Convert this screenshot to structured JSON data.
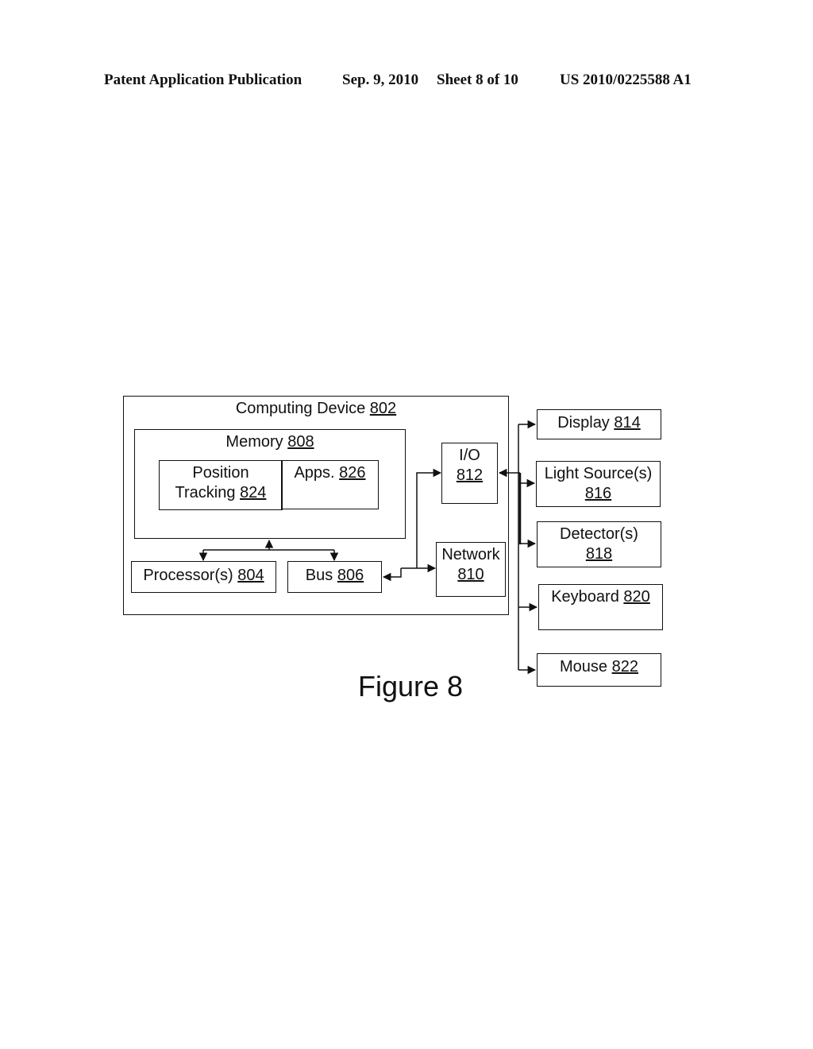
{
  "header": {
    "publication": "Patent Application Publication",
    "date": "Sep. 9, 2010",
    "sheet": "Sheet 8 of 10",
    "number": "US 2010/0225588 A1"
  },
  "diagram": {
    "computing_device": {
      "label": "Computing Device",
      "ref": "802"
    },
    "memory": {
      "label": "Memory",
      "ref": "808"
    },
    "position_tracking": {
      "label_line1": "Position",
      "label_line2": "Tracking",
      "ref": "824"
    },
    "apps": {
      "label": "Apps.",
      "ref": "826"
    },
    "processor": {
      "label": "Processor(s)",
      "ref": "804"
    },
    "bus": {
      "label": "Bus",
      "ref": "806"
    },
    "io": {
      "label": "I/O",
      "ref": "812"
    },
    "network": {
      "label": "Network",
      "ref": "810"
    },
    "display": {
      "label": "Display",
      "ref": "814"
    },
    "light_source": {
      "label": "Light Source(s)",
      "ref": "816"
    },
    "detector": {
      "label": "Detector(s)",
      "ref": "818"
    },
    "keyboard": {
      "label": "Keyboard",
      "ref": "820"
    },
    "mouse": {
      "label": "Mouse",
      "ref": "822"
    }
  },
  "caption": "Figure 8"
}
